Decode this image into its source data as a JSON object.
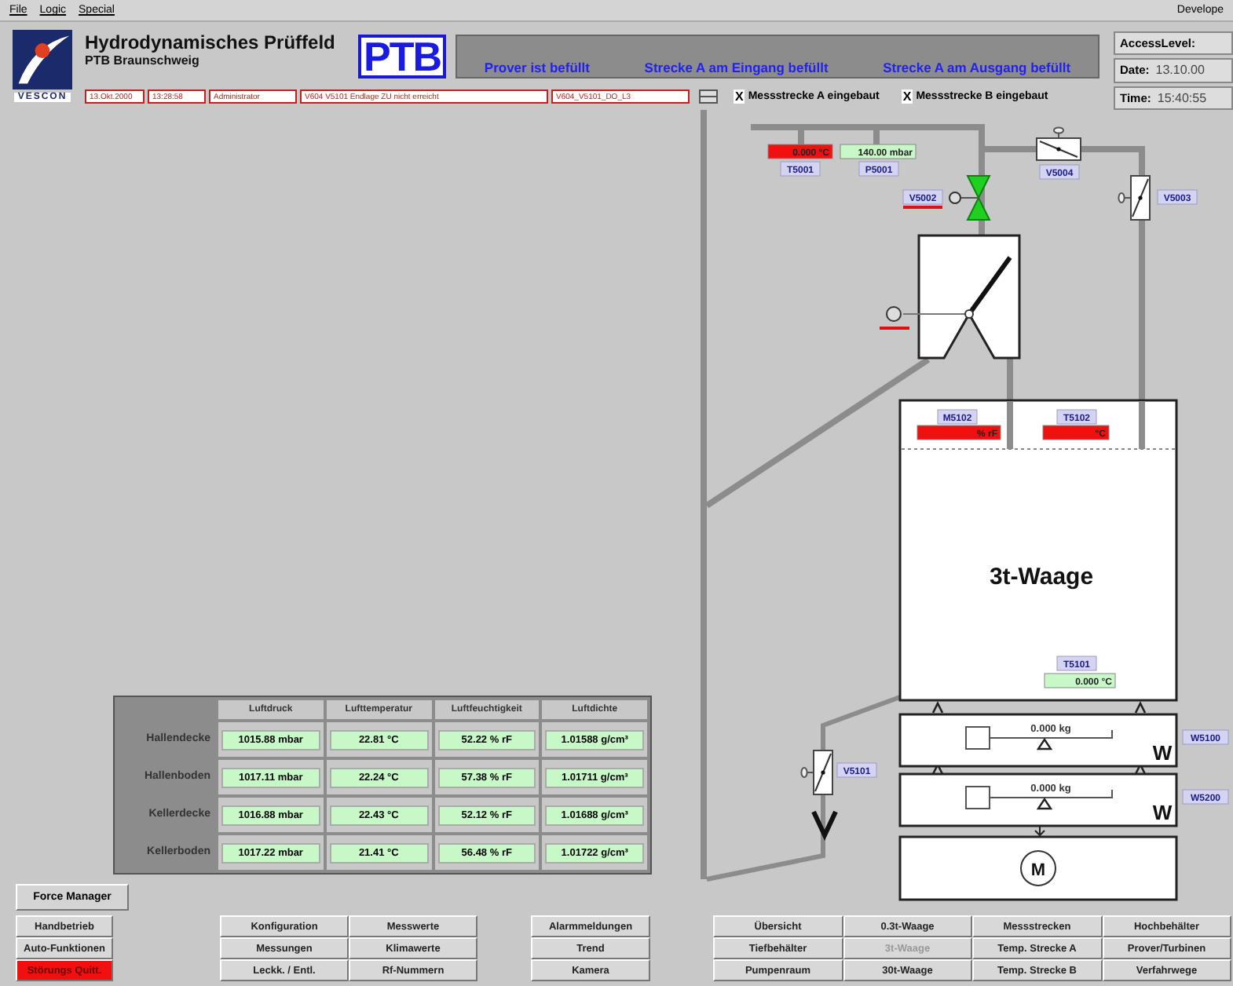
{
  "menu": [
    {
      "label": "File"
    },
    {
      "label": "Logic"
    },
    {
      "label": "Special"
    }
  ],
  "menu_right": "Develope",
  "header": {
    "title": "Hydrodynamisches Prüffeld",
    "subtitle": "PTB Braunschweig",
    "vendor": "VESCON",
    "institute_logo": "PTB"
  },
  "messages": [
    "Prover ist befüllt",
    "Strecke A am Eingang befüllt",
    "Strecke A am Ausgang befüllt"
  ],
  "access": [
    {
      "label": "AccessLevel:"
    },
    {
      "label": "Date:",
      "value": "13.10.00"
    },
    {
      "label": "Time:",
      "value": "15:40:55"
    }
  ],
  "status_fields": [
    "13.Okt.2000",
    "13:28:58",
    "Administrator",
    "V604 V5101 Endlage ZU nicht erreicht",
    "V604_V5101_DO_L3"
  ],
  "installed": [
    {
      "mark": "X",
      "label": "Messstrecke A eingebaut"
    },
    {
      "mark": "X",
      "label": "Messstrecke B eingebaut"
    }
  ],
  "diagram": {
    "readouts": [
      {
        "tag": "T5001",
        "value": "0.000 °C",
        "alarm": true
      },
      {
        "tag": "P5001",
        "value": "140.00 mbar",
        "alarm": false
      },
      {
        "tag": "M5102",
        "value": "% rF",
        "alarm": true
      },
      {
        "tag": "T5102",
        "value": "°C",
        "alarm": true
      },
      {
        "tag": "T5101",
        "value": "0.000 °C",
        "alarm": false
      }
    ],
    "valves": [
      {
        "tag": "V5002",
        "kind": "motor",
        "fault": true
      },
      {
        "tag": "V5004",
        "kind": "manual",
        "fault": false
      },
      {
        "tag": "V5003",
        "kind": "manual",
        "fault": false
      },
      {
        "tag": "V5101",
        "kind": "manual",
        "fault": false
      }
    ],
    "tank_title": "3t-Waage",
    "scales": [
      {
        "tag": "W5100",
        "reading": "0.000 kg",
        "symbol": "W"
      },
      {
        "tag": "W5200",
        "reading": "0.000 kg",
        "symbol": "W"
      }
    ],
    "motor": "M"
  },
  "table": {
    "columns": [
      "Luftdruck",
      "Lufttemperatur",
      "Luftfeuchtigkeit",
      "Luftdichte"
    ],
    "rows": [
      {
        "name": "Hallendecke",
        "cells": [
          "1015.88 mbar",
          "22.81 °C",
          "52.22 % rF",
          "1.01588 g/cm³"
        ]
      },
      {
        "name": "Hallenboden",
        "cells": [
          "1017.11 mbar",
          "22.24 °C",
          "57.38 % rF",
          "1.01711 g/cm³"
        ]
      },
      {
        "name": "Kellerdecke",
        "cells": [
          "1016.88 mbar",
          "22.43 °C",
          "52.12 % rF",
          "1.01688 g/cm³"
        ]
      },
      {
        "name": "Kellerboden",
        "cells": [
          "1017.22 mbar",
          "21.41 °C",
          "56.48 % rF",
          "1.01722 g/cm³"
        ]
      }
    ]
  },
  "force_button": "Force Manager",
  "nav_groups": [
    {
      "buttons": [
        {
          "label": "Handbetrieb",
          "kind": "normal"
        },
        {
          "label": "Auto-Funktionen",
          "kind": "normal"
        },
        {
          "label": "Störungs Quitt.",
          "kind": "alarm"
        }
      ]
    },
    {
      "buttons": [
        {
          "label": "Konfiguration",
          "kind": "normal"
        },
        {
          "label": "Messwerte",
          "kind": "normal"
        },
        {
          "label": "Messungen",
          "kind": "normal"
        },
        {
          "label": "Klimawerte",
          "kind": "normal"
        },
        {
          "label": "Leckk. / Entl.",
          "kind": "normal"
        },
        {
          "label": "Rf-Nummern",
          "kind": "normal"
        }
      ]
    },
    {
      "buttons": [
        {
          "label": "Alarmmeldungen",
          "kind": "normal"
        },
        {
          "label": "Trend",
          "kind": "normal"
        },
        {
          "label": "Kamera",
          "kind": "normal"
        }
      ]
    },
    {
      "buttons": [
        {
          "label": "Übersicht",
          "kind": "normal"
        },
        {
          "label": "0.3t-Waage",
          "kind": "normal"
        },
        {
          "label": "Messstrecken",
          "kind": "normal"
        },
        {
          "label": "Hochbehälter",
          "kind": "normal"
        },
        {
          "label": "Tiefbehälter",
          "kind": "normal"
        },
        {
          "label": "3t-Waage",
          "kind": "disabled"
        },
        {
          "label": "Temp. Strecke A",
          "kind": "normal"
        },
        {
          "label": "Prover/Turbinen",
          "kind": "normal"
        },
        {
          "label": "Pumpenraum",
          "kind": "normal"
        },
        {
          "label": "30t-Waage",
          "kind": "normal"
        },
        {
          "label": "Temp. Strecke B",
          "kind": "normal"
        },
        {
          "label": "Verfahrwege",
          "kind": "normal"
        }
      ]
    }
  ]
}
